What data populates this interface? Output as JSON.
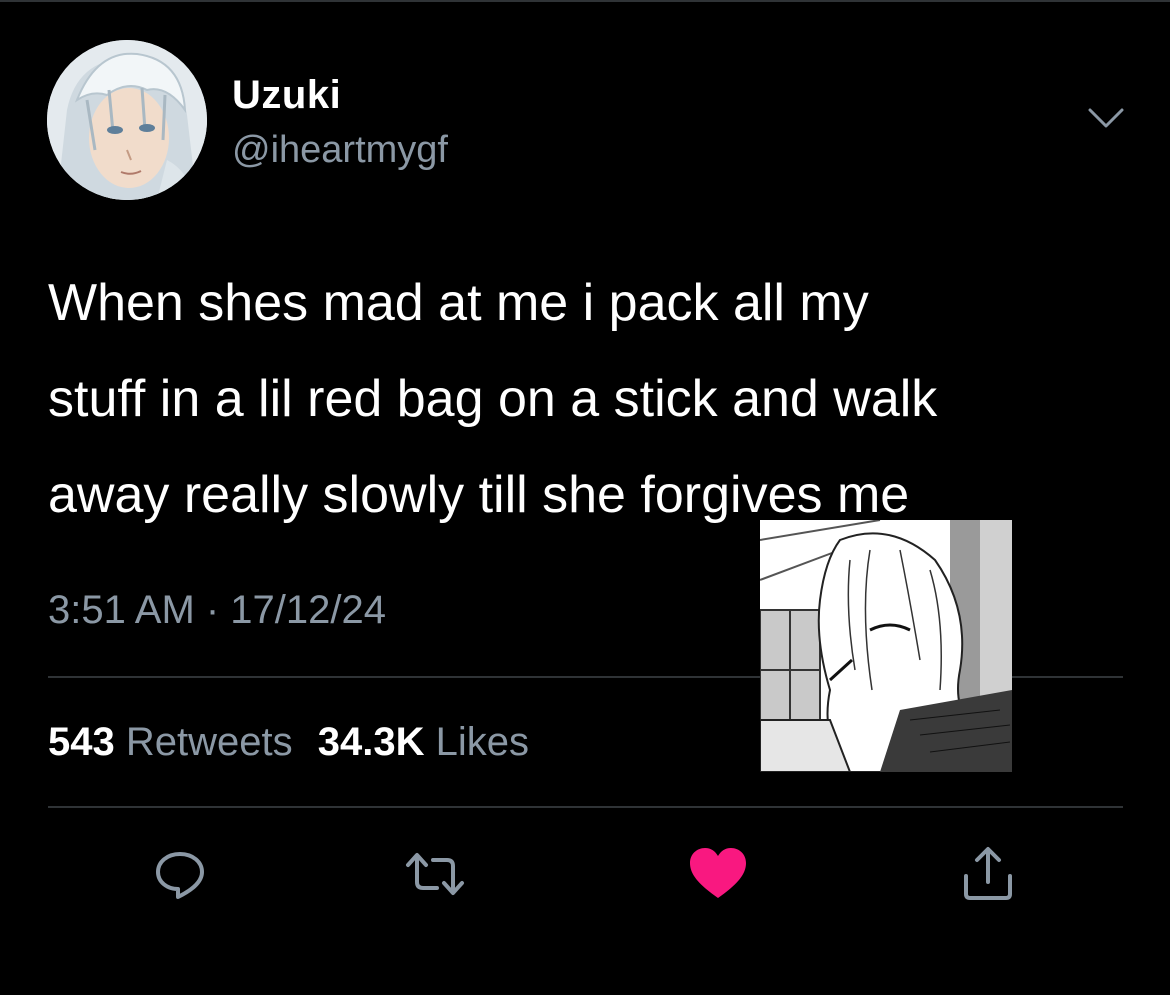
{
  "tweet": {
    "display_name": "Uzuki",
    "handle": "@iheartmygf",
    "text_lines": [
      "When shes mad at me i pack all my",
      "stuff in a lil red bag on a stick and walk",
      "away really slowly till she forgives me"
    ],
    "timestamp": "3:51 AM · 17/12/24",
    "stats": {
      "retweets_count": "543",
      "retweets_label": "Retweets",
      "likes_count": "34.3K",
      "likes_label": "Likes"
    }
  },
  "actions": {
    "reply_icon": "reply-icon",
    "retweet_icon": "retweet-icon",
    "like_icon": "heart-icon",
    "share_icon": "share-icon",
    "liked": true
  },
  "colors": {
    "background": "#000000",
    "primary_text": "#ffffff",
    "secondary_text": "#8b98a5",
    "divider": "#2f3336",
    "like_active": "#f91880"
  }
}
